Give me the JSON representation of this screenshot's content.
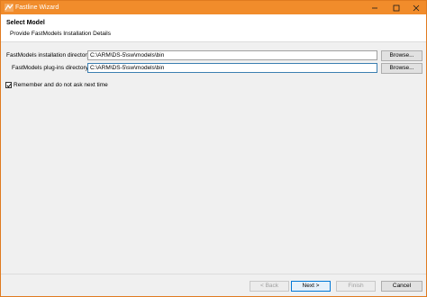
{
  "window": {
    "title": "Fastline Wizard",
    "accent_color": "#f18c2b"
  },
  "header": {
    "title": "Select Model",
    "description": "Provide FastModels Installation Details"
  },
  "form": {
    "install_dir": {
      "label": "FastModels installation directory:",
      "value": "C:\\ARM\\DS-5\\sw\\models\\bin",
      "browse_label": "Browse..."
    },
    "plugins_dir": {
      "label": "FastModels plug-ins directory:",
      "value": "C:\\ARM\\DS-5\\sw\\models\\bin",
      "browse_label": "Browse..."
    },
    "remember": {
      "label": "Remember and do not ask next time",
      "checked": true
    }
  },
  "footer": {
    "back_label": "< Back",
    "next_label": "Next >",
    "finish_label": "Finish",
    "cancel_label": "Cancel"
  }
}
